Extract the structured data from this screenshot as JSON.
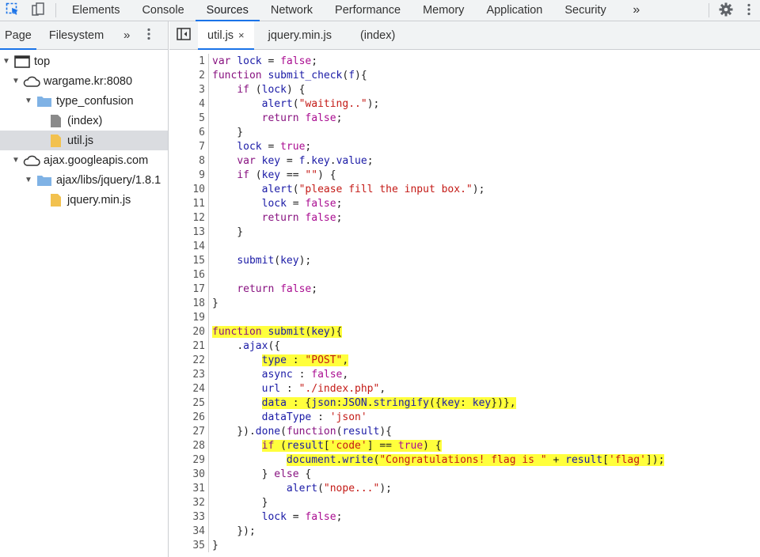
{
  "toolbar": {
    "tabs": [
      "Elements",
      "Console",
      "Sources",
      "Network",
      "Performance",
      "Memory",
      "Application",
      "Security"
    ],
    "active_tab": "Sources",
    "more": "»"
  },
  "navigator": {
    "tabs": [
      "Page",
      "Filesystem"
    ],
    "more": "»",
    "tree": [
      {
        "label": "top",
        "level": 0,
        "icon": "frame-icon",
        "expanded": true
      },
      {
        "label": "wargame.kr:8080",
        "level": 1,
        "icon": "cloud-icon",
        "expanded": true
      },
      {
        "label": "type_confusion",
        "level": 2,
        "icon": "folder-icon",
        "expanded": true
      },
      {
        "label": "(index)",
        "level": 3,
        "icon": "document-icon"
      },
      {
        "label": "util.js",
        "level": 3,
        "icon": "js-file-icon",
        "selected": true
      },
      {
        "label": "ajax.googleapis.com",
        "level": 1,
        "icon": "cloud-icon",
        "expanded": true
      },
      {
        "label": "ajax/libs/jquery/1.8.1",
        "level": 2,
        "icon": "folder-icon",
        "expanded": true
      },
      {
        "label": "jquery.min.js",
        "level": 3,
        "icon": "js-file-icon"
      }
    ]
  },
  "editor": {
    "tabs": [
      {
        "label": "util.js",
        "active": true,
        "closable": true
      },
      {
        "label": "jquery.min.js"
      },
      {
        "label": "(index)"
      }
    ],
    "close_glyph": "×"
  },
  "code_lines": [
    "var lock = false;",
    "function submit_check(f){",
    "    if (lock) {",
    "        alert(\"waiting..\");",
    "        return false;",
    "    }",
    "    lock = true;",
    "    var key = f.key.value;",
    "    if (key == \"\") {",
    "        alert(\"please fill the input box.\");",
    "        lock = false;",
    "        return false;",
    "    }",
    "",
    "    submit(key);",
    "",
    "    return false;",
    "}",
    "",
    "function submit(key){",
    "    $.ajax({",
    "        type : \"POST\",",
    "        async : false,",
    "        url : \"./index.php\",",
    "        data : {json:JSON.stringify({key: key})},",
    "        dataType : 'json'",
    "    }).done(function(result){",
    "        if (result['code'] == true) {",
    "            document.write(\"Congratulations! flag is \" + result['flag']);",
    "        } else {",
    "            alert(\"nope...\");",
    "        }",
    "        lock = false;",
    "    });",
    "}"
  ],
  "highlighted_lines": [
    20,
    22,
    25,
    28,
    29
  ]
}
